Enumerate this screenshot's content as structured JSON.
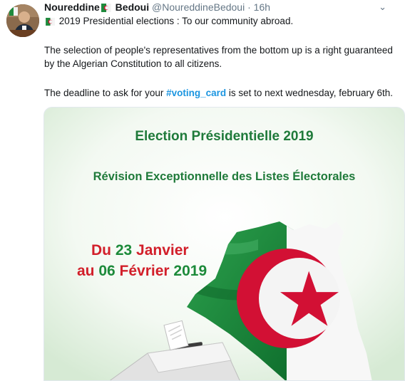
{
  "tweet": {
    "author_name": "Noureddine",
    "author_name_suffix": "Bedoui",
    "handle": "@NoureddineBedoui",
    "separator": "·",
    "time": "16h",
    "caret": "⌄",
    "line1": "2019 Presidential elections : To our community abroad.",
    "para2": "The selection of people's representatives from the bottom up is a right guaranteed by the Algerian Constitution to all citizens.",
    "para3_before": "The deadline to ask for your ",
    "hashtag": "#voting_card",
    "para3_after": " is set to next wednesday, february 6th."
  },
  "poster": {
    "title": "Election Présidentielle 2019",
    "subtitle": "Révision Exceptionnelle des Listes Électorales",
    "du": "Du ",
    "du_num": "23",
    "du_month": " Janvier",
    "au": "au ",
    "au_num": "06",
    "au_month": " Février",
    "au_year": " 2019"
  },
  "colors": {
    "flag_green": "#1f8a3d",
    "flag_red": "#d21034",
    "link": "#1b95e0",
    "poster_text": "#1f7a3a"
  },
  "icons": [
    "algeria-flag-icon",
    "caret-down-icon"
  ]
}
